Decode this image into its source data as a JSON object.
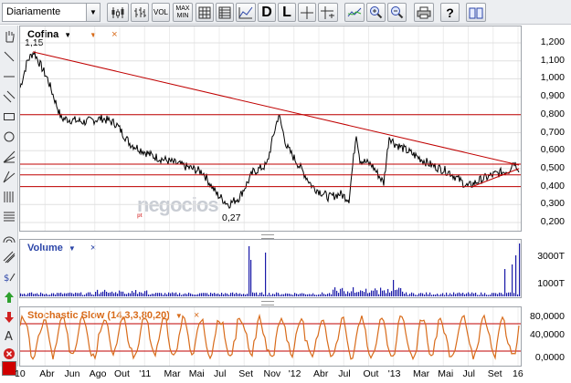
{
  "toolbar": {
    "period": "Diariamente",
    "vol_label": "VOL",
    "maxmin_top": "MAX",
    "maxmin_bottom": "MIN",
    "d_label": "D",
    "l_label": "L",
    "help_label": "?"
  },
  "price_panel": {
    "title": "Cofina",
    "high_label": "1,15",
    "low_label": "0,27",
    "y_labels": [
      "1,200",
      "1,100",
      "1,000",
      "0,900",
      "0,800",
      "0,700",
      "0,600",
      "0,500",
      "0,400",
      "0,300",
      "0,200"
    ]
  },
  "volume_panel": {
    "title": "Volume",
    "y_labels": [
      "3000T",
      "1000T"
    ]
  },
  "stoch_panel": {
    "title": "Stochastic Slow (14,3,3,80,20)",
    "y_labels": [
      "80,0000",
      "40,0000",
      "0,0000"
    ]
  },
  "x_labels": [
    "10",
    "Abr",
    "Jun",
    "Ago",
    "Out",
    "'11",
    "Mar",
    "Mai",
    "Jul",
    "Set",
    "Nov",
    "'12",
    "Abr",
    "Jul",
    "Out",
    "'13",
    "Mar",
    "Mai",
    "Jul",
    "Set",
    "16"
  ],
  "watermark": "negocios",
  "watermark_sub": "pt",
  "colors": {
    "price_line": "#000000",
    "trend": "#c00000",
    "volume": "#1a1aa8",
    "stoch": "#d86b1a",
    "grid": "#e0e0e0"
  }
}
